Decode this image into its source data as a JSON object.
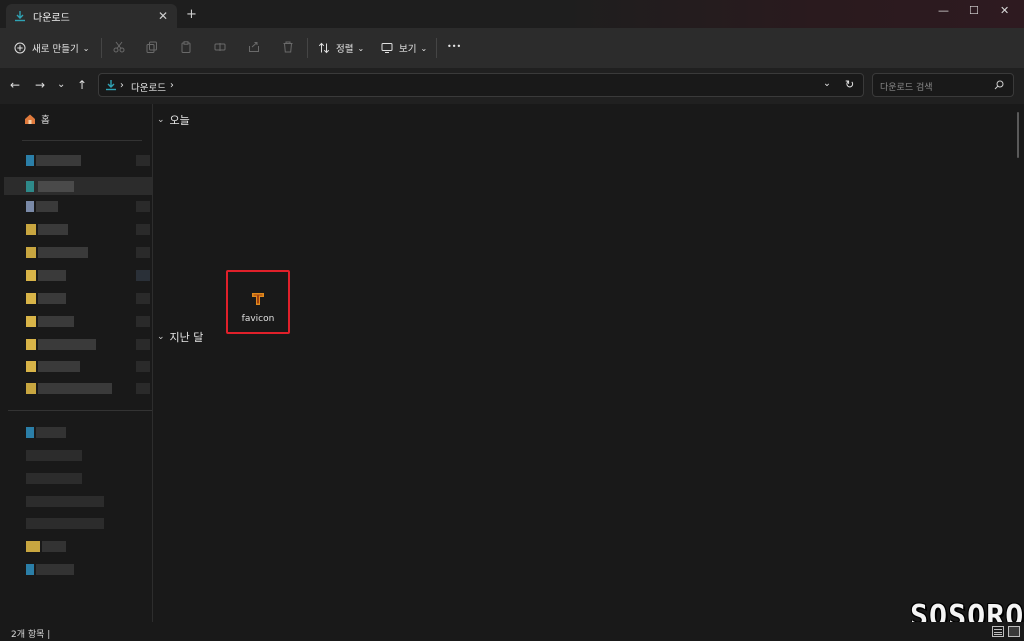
{
  "tab": {
    "title": "다운로드",
    "close": "✕",
    "new_tab": "+"
  },
  "window_controls": {
    "minimize": "—",
    "maximize": "☐",
    "close": "✕"
  },
  "toolbar": {
    "new_label": "새로 만들기",
    "sort_label": "정렬",
    "view_label": "보기",
    "more": "•••",
    "dropdown_glyph": "⌄"
  },
  "address": {
    "breadcrumb": [
      "다운로드"
    ],
    "separator": "›",
    "dropdown_glyph": "⌄",
    "refresh_glyph": "↻"
  },
  "nav": {
    "back": "←",
    "forward": "→",
    "recent": "⌄",
    "up": "↑"
  },
  "search": {
    "placeholder": "다운로드 검색"
  },
  "sidebar": {
    "home_label": "홈"
  },
  "content": {
    "groups": [
      {
        "label": "오늘",
        "chevron": "⌄"
      },
      {
        "label": "지난 달",
        "chevron": "⌄"
      }
    ],
    "files": [
      {
        "name": "favicon",
        "icon": "text-file-icon"
      }
    ]
  },
  "watermark": "SOSORO",
  "status": {
    "items_text": "2개 항목  |"
  },
  "colors": {
    "accent_download": "#2fa3b5",
    "selection_border": "#e0202a",
    "favicon_orange": "#e08a1c"
  }
}
